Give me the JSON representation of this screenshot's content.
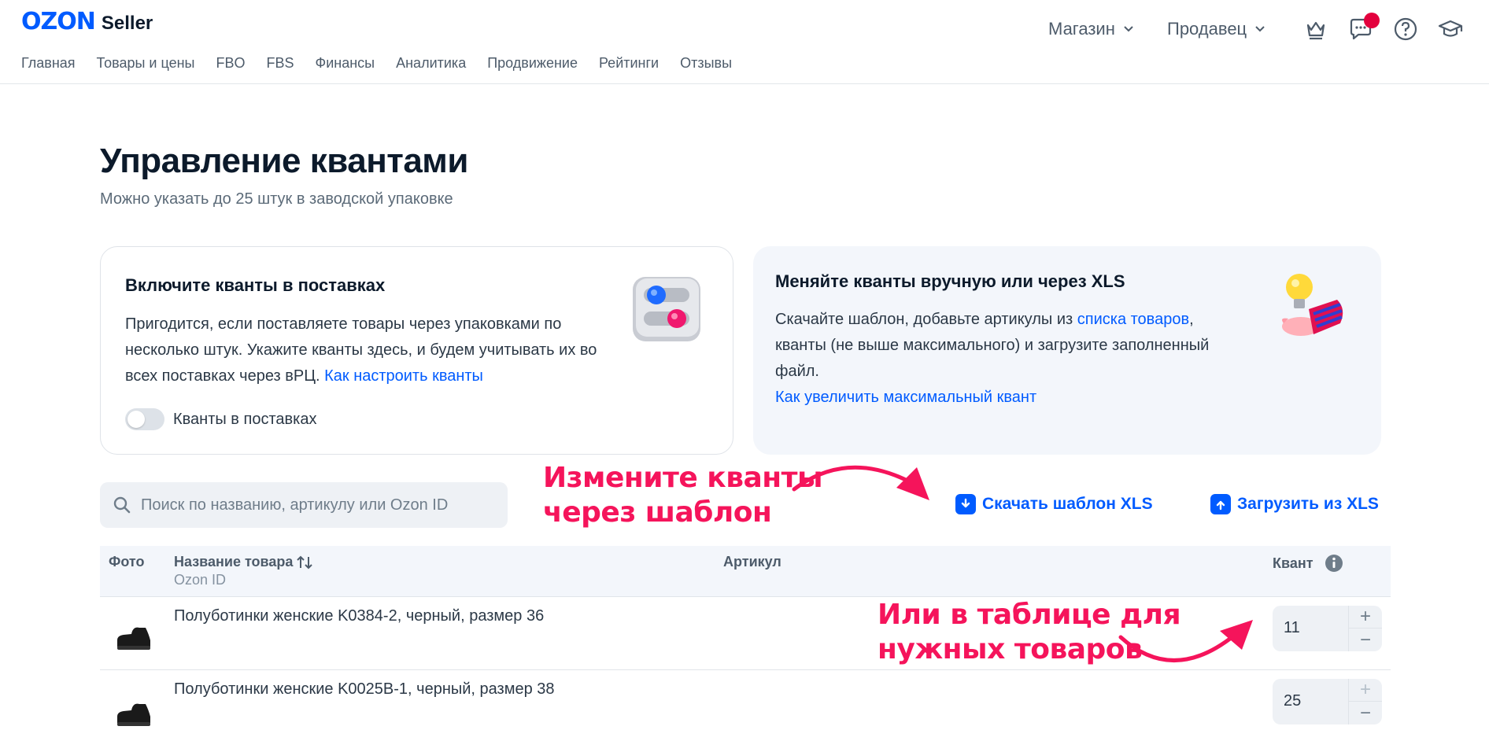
{
  "header": {
    "logo_brand": "OZON",
    "logo_product": "Seller",
    "nav": [
      "Главная",
      "Товары и цены",
      "FBO",
      "FBS",
      "Финансы",
      "Аналитика",
      "Продвижение",
      "Рейтинги",
      "Отзывы"
    ],
    "store_dropdown": "Магазин",
    "seller_dropdown": "Продавец",
    "icons": [
      "crown-icon",
      "chat-icon",
      "help-icon",
      "graduation-cap-icon"
    ],
    "notification_color": "#e3003d"
  },
  "page": {
    "title": "Управление квантами",
    "subtitle": "Можно указать до 25 штук в заводской упаковке"
  },
  "card_left": {
    "title": "Включите кванты в поставках",
    "text": "Пригодится, если поставляете товары через упаковками по несколько штук. Укажите кванты здесь, и будем учитывать их во всех поставках через вРЦ.",
    "link": "Как настроить кванты",
    "toggle_label": "Кванты в поставках",
    "toggle_on": false
  },
  "card_right": {
    "title": "Меняйте кванты вручную или через XLS",
    "text_before": "Скачайте шаблон, добавьте артикулы из",
    "text_link": "списка товаров",
    "text_after": ", кванты (не выше максимального) и загрузите заполненный файл.",
    "link": "Как увеличить максимальный квант"
  },
  "search": {
    "placeholder": "Поиск по названию, артикулу или Ozon ID",
    "value": ""
  },
  "actions": {
    "download": "Скачать шаблон XLS",
    "upload": "Загрузить из XLS"
  },
  "annotations": {
    "template": [
      "Измените кванты",
      "через шаблон"
    ],
    "table": [
      "Или в таблице для",
      "нужных товаров"
    ]
  },
  "table": {
    "columns": {
      "photo": "Фото",
      "name": "Название товара",
      "name_sub": "Ozon ID",
      "article": "Артикул",
      "quant": "Квант"
    },
    "rows": [
      {
        "name": "Полуботинки женские K0384-2, черный, размер 36",
        "quant": "11"
      },
      {
        "name": "Полуботинки женские K0025B-1, черный, размер 38",
        "quant": "25"
      }
    ]
  },
  "colors": {
    "accent": "#005bff",
    "annotation": "#f5145b",
    "card_bg": "#f3f6fb"
  }
}
